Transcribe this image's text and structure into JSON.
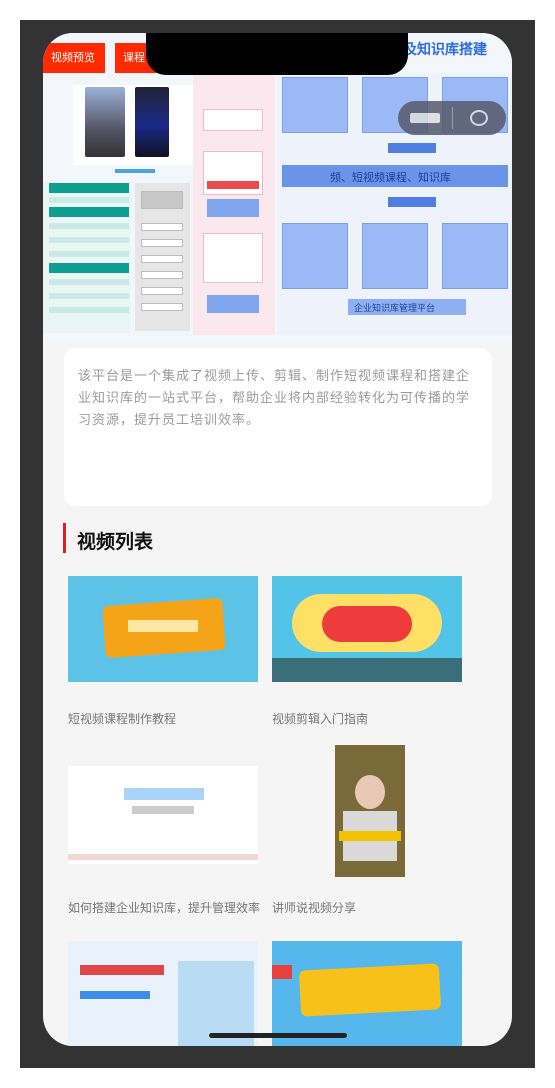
{
  "banner": {
    "tag_left": "视频预览",
    "tag_right": "课程",
    "title": "及知识库搭建",
    "center_label": "频、短视频课程、知识库",
    "footer_label": "企业知识库管理平台"
  },
  "description": {
    "text": "该平台是一个集成了视频上传、剪辑、制作短视频课程和搭建企业知识库的一站式平台，帮助企业将内部经验转化为可传播的学习资源，提升员工培训效率。"
  },
  "section": {
    "title": "视频列表"
  },
  "videos": [
    {
      "title": "短视频课程制作教程"
    },
    {
      "title": "视频剪辑入门指南"
    },
    {
      "title": "如何搭建企业知识库，提升管理效率"
    },
    {
      "title": "讲师说视频分享"
    },
    {
      "title": ""
    },
    {
      "title": ""
    }
  ],
  "colors": {
    "accent": "#e02020",
    "banner_blue": "#2d6cdf",
    "teal": "#0e9d8e",
    "frame": "#333333"
  }
}
